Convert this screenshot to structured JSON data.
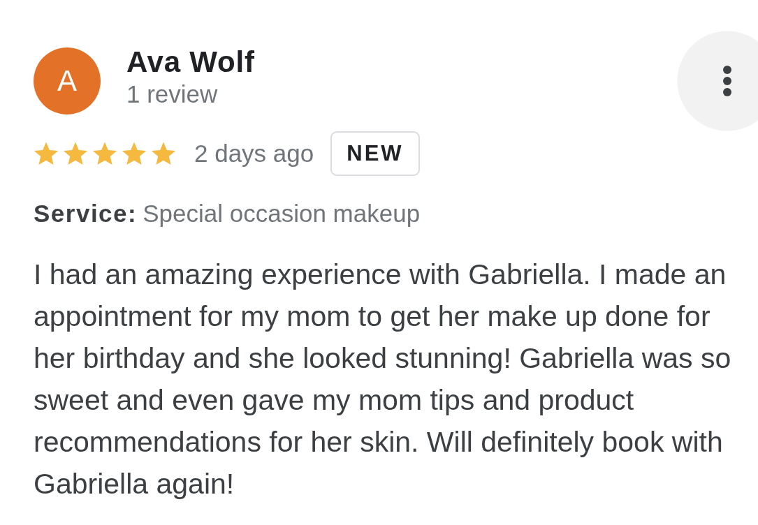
{
  "reviewer": {
    "initial": "A",
    "name": "Ava Wolf",
    "review_count": "1 review"
  },
  "rating": {
    "stars": 5,
    "time": "2 days ago",
    "badge": "NEW"
  },
  "service": {
    "label": "Service:",
    "value": "Special occasion makeup"
  },
  "review_text": "I had an amazing experience with Gabriella. I made an appointment for my mom to get her make up done for her birthday and she looked stunning! Gabriella was so sweet and even gave my mom tips and product recommendations for her skin. Will definitely book with Gabriella again!"
}
